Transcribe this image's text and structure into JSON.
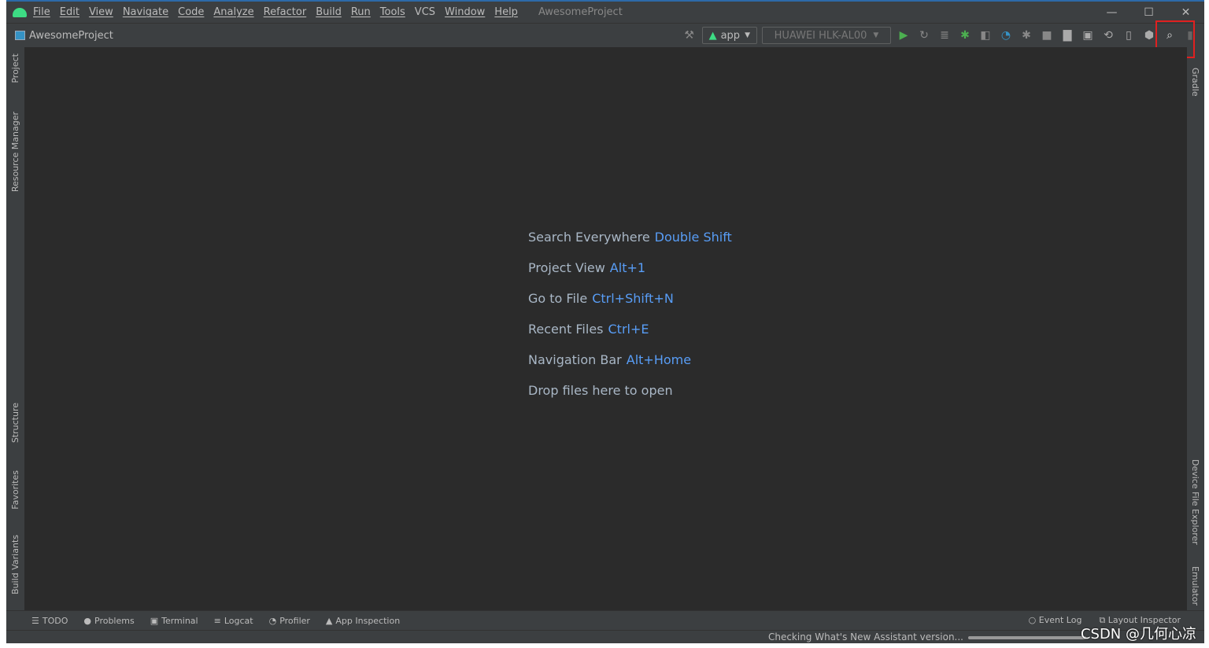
{
  "menu": {
    "items": [
      "File",
      "Edit",
      "View",
      "Navigate",
      "Code",
      "Analyze",
      "Refactor",
      "Build",
      "Run",
      "Tools",
      "VCS",
      "Window",
      "Help"
    ],
    "title": "AwesomeProject"
  },
  "window_controls": {
    "minimize": "—",
    "maximize": "☐",
    "close": "✕"
  },
  "navbar": {
    "project": "AwesomeProject"
  },
  "toolbar": {
    "config": "app",
    "device": "HUAWEI HLK-AL00",
    "accent": "#e02020"
  },
  "left_tools": [
    "Project",
    "Resource Manager",
    "Structure",
    "Favorites",
    "Build Variants"
  ],
  "right_tools": [
    "Gradle",
    "Device File Explorer",
    "Emulator"
  ],
  "hints": [
    {
      "label": "Search Everywhere",
      "key": "Double Shift"
    },
    {
      "label": "Project View",
      "key": "Alt+1"
    },
    {
      "label": "Go to File",
      "key": "Ctrl+Shift+N"
    },
    {
      "label": "Recent Files",
      "key": "Ctrl+E"
    },
    {
      "label": "Navigation Bar",
      "key": "Alt+Home"
    },
    {
      "label": "Drop files here to open",
      "key": ""
    }
  ],
  "bottom_tools": [
    "TODO",
    "Problems",
    "Terminal",
    "Logcat",
    "Profiler",
    "App Inspection"
  ],
  "bottom_right": [
    "Event Log",
    "Layout Inspector"
  ],
  "status": {
    "message": "Checking What's New Assistant version..."
  },
  "watermark": "CSDN @几何心凉"
}
